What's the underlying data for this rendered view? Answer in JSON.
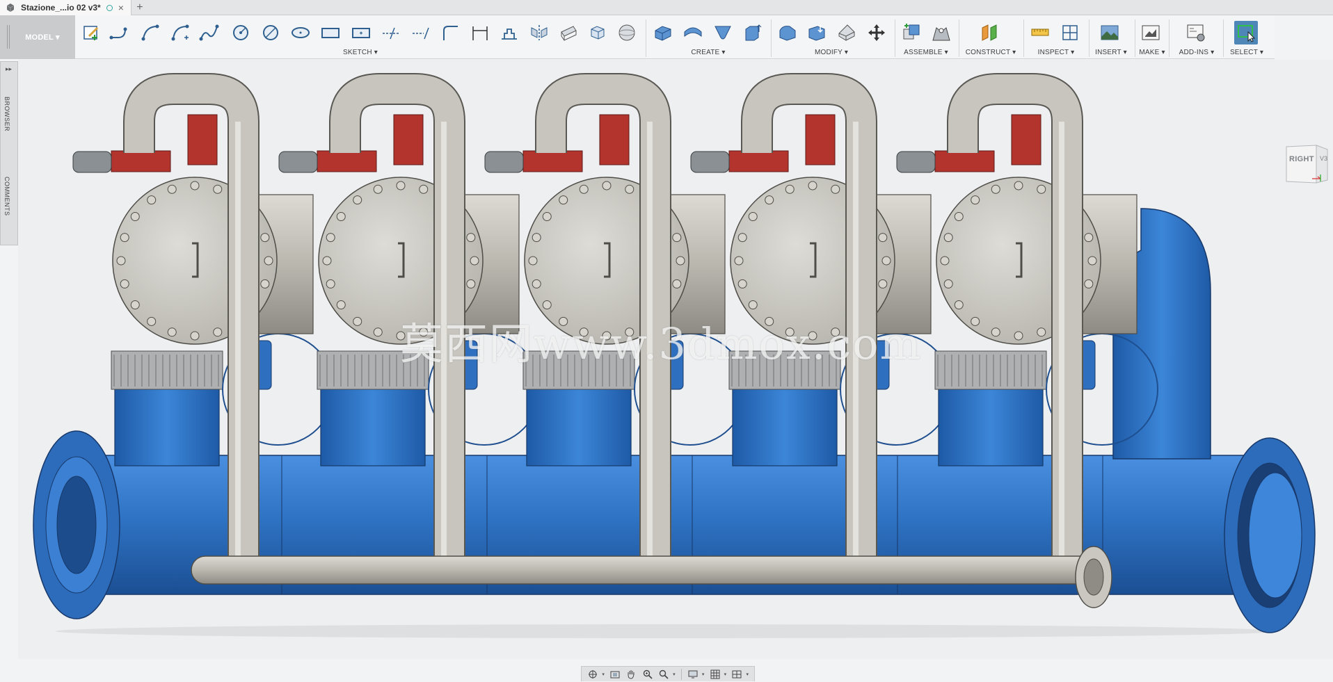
{
  "app": {
    "tab_title": "Stazione_...io 02 v3*",
    "new_tab_symbol": "+",
    "close_symbol": "×"
  },
  "toolbar": {
    "workspace_label": "MODEL ▾",
    "groups": [
      {
        "label": "SKETCH ▾"
      },
      {
        "label": "CREATE ▾"
      },
      {
        "label": "MODIFY ▾"
      },
      {
        "label": "ASSEMBLE ▾"
      },
      {
        "label": "CONSTRUCT ▾"
      },
      {
        "label": "INSPECT ▾"
      },
      {
        "label": "INSERT ▾"
      },
      {
        "label": "MAKE ▾"
      },
      {
        "label": "ADD-INS ▾"
      },
      {
        "label": "SELECT ▾"
      }
    ]
  },
  "side_panel": {
    "toggle": "▸▸",
    "browser_label": "BROWSER",
    "comments_label": "COMMENTS"
  },
  "viewcube": {
    "face": "RIGHT",
    "side": "V3"
  },
  "watermark": "莫西网www.3dmox.com",
  "colors": {
    "pipe_blue": "#2f73c4",
    "steel_gray": "#b9b7ae",
    "valve_red": "#b3342d",
    "active_tool": "#4f86b8"
  }
}
